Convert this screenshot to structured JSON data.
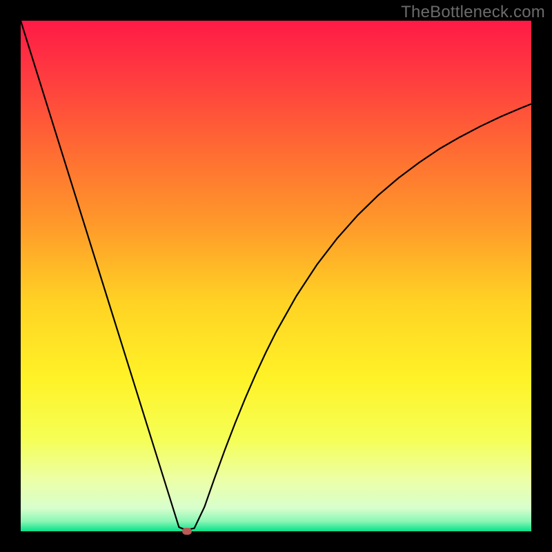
{
  "watermark": "TheBottleneck.com",
  "chart_data": {
    "type": "line",
    "title": "",
    "xlabel": "",
    "ylabel": "",
    "xlim": [
      0,
      100
    ],
    "ylim": [
      0,
      100
    ],
    "grid": false,
    "background_gradient": {
      "stops": [
        {
          "pos": 0.0,
          "color": "#ff1a46"
        },
        {
          "pos": 0.12,
          "color": "#ff3f3f"
        },
        {
          "pos": 0.25,
          "color": "#ff6a33"
        },
        {
          "pos": 0.4,
          "color": "#ff9a2a"
        },
        {
          "pos": 0.55,
          "color": "#ffd224"
        },
        {
          "pos": 0.7,
          "color": "#fff227"
        },
        {
          "pos": 0.82,
          "color": "#f5ff56"
        },
        {
          "pos": 0.9,
          "color": "#ecffa7"
        },
        {
          "pos": 0.955,
          "color": "#d7ffcd"
        },
        {
          "pos": 0.98,
          "color": "#8cf7b5"
        },
        {
          "pos": 1.0,
          "color": "#06e188"
        }
      ]
    },
    "series": [
      {
        "name": "bottleneck-curve",
        "color": "#000000",
        "x": [
          0,
          2,
          4,
          6,
          8,
          10,
          12,
          14,
          16,
          18,
          20,
          22,
          24,
          26,
          28,
          29,
          30,
          31,
          32,
          33,
          34,
          36,
          38,
          40,
          42,
          44,
          46,
          48,
          50,
          54,
          58,
          62,
          66,
          70,
          74,
          78,
          82,
          86,
          90,
          94,
          98,
          100
        ],
        "y": [
          100,
          93.6,
          87.2,
          80.8,
          74.4,
          68.0,
          61.6,
          55.2,
          48.8,
          42.4,
          36.0,
          29.6,
          23.2,
          16.8,
          10.4,
          7.2,
          4.0,
          0.8,
          0.4,
          0.4,
          0.6,
          4.8,
          10.5,
          16.0,
          21.2,
          26.1,
          30.7,
          35.0,
          39.0,
          46.1,
          52.2,
          57.4,
          61.9,
          65.8,
          69.2,
          72.2,
          74.9,
          77.2,
          79.3,
          81.2,
          82.9,
          83.7
        ]
      }
    ],
    "marker": {
      "x": 32.5,
      "y": 0.0,
      "color": "#b95a55"
    }
  }
}
